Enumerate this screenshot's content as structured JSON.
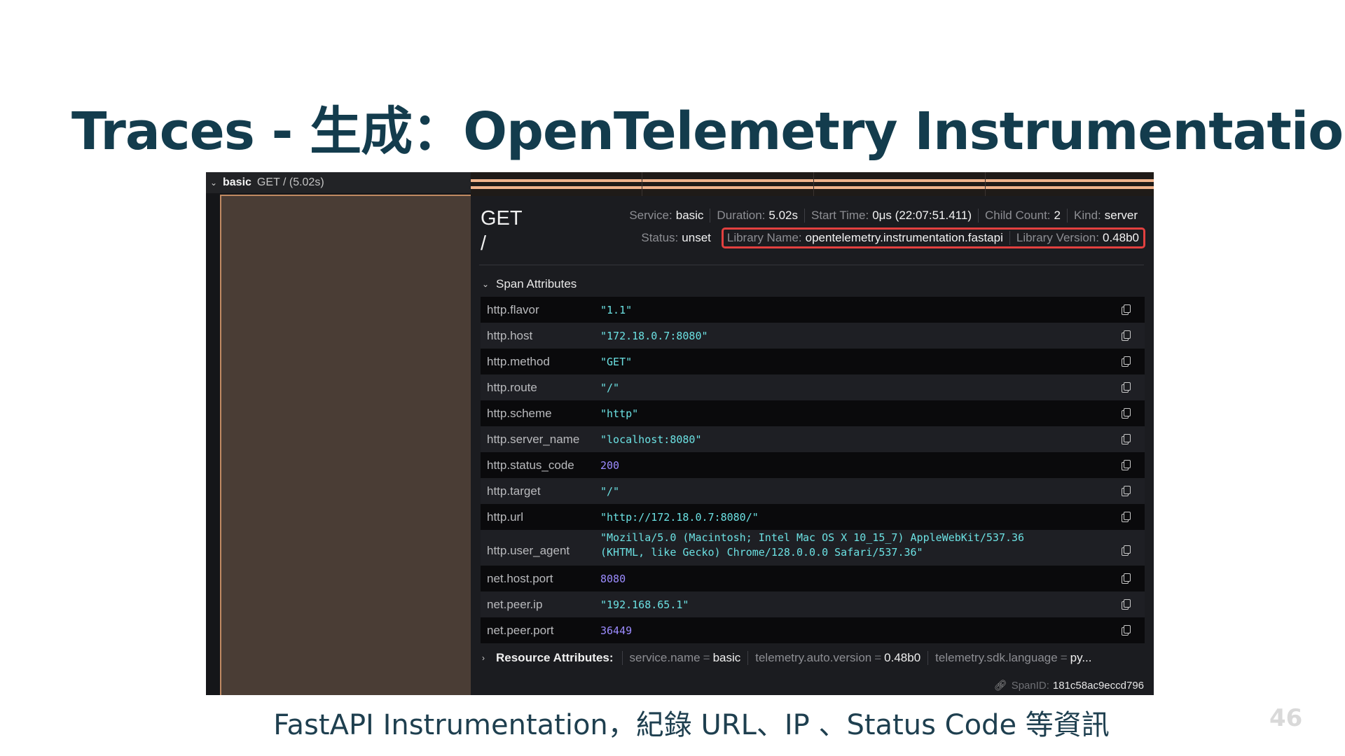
{
  "slide": {
    "title": "Traces - 生成：OpenTelemetry Instrumentation",
    "caption": "FastAPI Instrumentation，紀錄 URL、IP 、Status Code 等資訊",
    "page_number": "46"
  },
  "trace_list": {
    "service": "basic",
    "operation": "GET / (5.02s)"
  },
  "span": {
    "operation_line1": "GET",
    "operation_line2": "/",
    "service": {
      "label": "Service:",
      "value": "basic"
    },
    "duration": {
      "label": "Duration:",
      "value": "5.02s"
    },
    "start_time": {
      "label": "Start Time:",
      "value": "0μs (22:07:51.411)"
    },
    "child_count": {
      "label": "Child Count:",
      "value": "2"
    },
    "kind": {
      "label": "Kind:",
      "value": "server"
    },
    "status": {
      "label": "Status:",
      "value": "unset"
    },
    "library_name": {
      "label": "Library Name:",
      "value": "opentelemetry.instrumentation.fastapi"
    },
    "library_version": {
      "label": "Library Version:",
      "value": "0.48b0"
    }
  },
  "span_attributes": {
    "title": "Span Attributes",
    "rows": [
      {
        "key": "http.flavor",
        "value": "\"1.1\"",
        "type": "string"
      },
      {
        "key": "http.host",
        "value": "\"172.18.0.7:8080\"",
        "type": "string"
      },
      {
        "key": "http.method",
        "value": "\"GET\"",
        "type": "string"
      },
      {
        "key": "http.route",
        "value": "\"/\"",
        "type": "string"
      },
      {
        "key": "http.scheme",
        "value": "\"http\"",
        "type": "string"
      },
      {
        "key": "http.server_name",
        "value": "\"localhost:8080\"",
        "type": "string"
      },
      {
        "key": "http.status_code",
        "value": "200",
        "type": "number"
      },
      {
        "key": "http.target",
        "value": "\"/\"",
        "type": "string"
      },
      {
        "key": "http.url",
        "value": "\"http://172.18.0.7:8080/\"",
        "type": "string"
      },
      {
        "key": "http.user_agent",
        "value": "\"Mozilla/5.0 (Macintosh; Intel Mac OS X 10_15_7) AppleWebKit/537.36\n(KHTML, like Gecko) Chrome/128.0.0.0 Safari/537.36\"",
        "type": "string"
      },
      {
        "key": "net.host.port",
        "value": "8080",
        "type": "number"
      },
      {
        "key": "net.peer.ip",
        "value": "\"192.168.65.1\"",
        "type": "string"
      },
      {
        "key": "net.peer.port",
        "value": "36449",
        "type": "number"
      }
    ]
  },
  "resource_attributes": {
    "label": "Resource Attributes:",
    "items": [
      {
        "key": "service.name",
        "value": "basic"
      },
      {
        "key": "telemetry.auto.version",
        "value": "0.48b0"
      },
      {
        "key": "telemetry.sdk.language",
        "value": "py..."
      }
    ]
  },
  "span_id": {
    "label": "SpanID:",
    "value": "181c58ac9eccd796"
  },
  "colors": {
    "title": "#133c4d",
    "highlight_box": "#e2403f",
    "string_value": "#6be0e2",
    "number_value": "#9c8cff",
    "span_bar": "#f0b38c"
  }
}
